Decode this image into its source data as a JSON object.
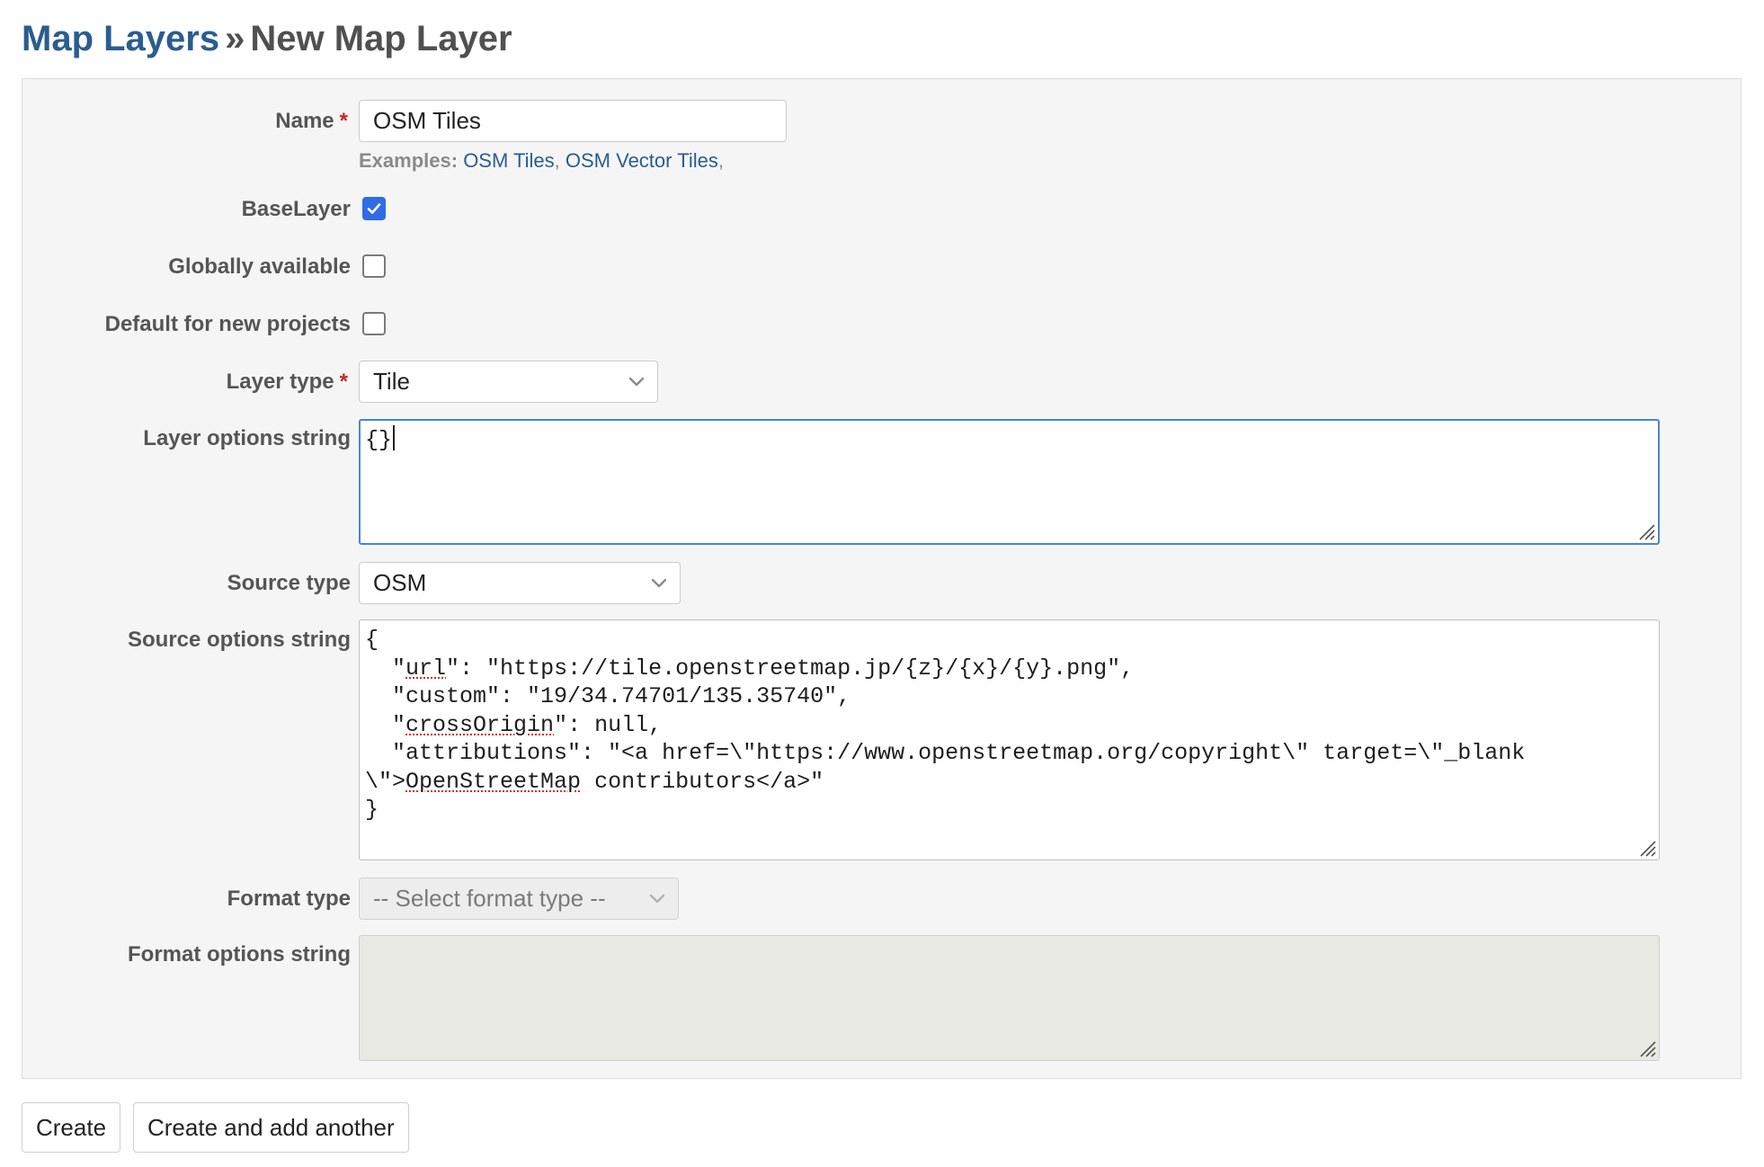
{
  "breadcrumb": {
    "parent_label": "Map Layers",
    "separator": "»",
    "current_label": "New Map Layer"
  },
  "form": {
    "name": {
      "label": "Name",
      "required_mark": "*",
      "value": "OSM Tiles",
      "help_label": "Examples:",
      "examples": [
        "OSM Tiles",
        "OSM Vector Tiles"
      ]
    },
    "base_layer": {
      "label": "BaseLayer",
      "checked": true
    },
    "globally_available": {
      "label": "Globally available",
      "checked": false
    },
    "default_for_new_projects": {
      "label": "Default for new projects",
      "checked": false
    },
    "layer_type": {
      "label": "Layer type",
      "required_mark": "*",
      "selected": "Tile"
    },
    "layer_options": {
      "label": "Layer options string",
      "value": "{}"
    },
    "source_type": {
      "label": "Source type",
      "selected": "OSM"
    },
    "source_options": {
      "label": "Source options string",
      "lines": [
        "{",
        "  \"url\": \"https://tile.openstreetmap.jp/{z}/{x}/{y}.png\",",
        "  \"custom\": \"19/34.74701/135.35740\",",
        "  \"crossOrigin\": null,",
        "  \"attributions\": \"<a href=\\\"https://www.openstreetmap.org/copyright\\\" target=\\\"_blank",
        "\\\">OpenStreetMap contributors</a>\"",
        "}"
      ]
    },
    "format_type": {
      "label": "Format type",
      "placeholder": "-- Select format type --",
      "disabled": true
    },
    "format_options": {
      "label": "Format options string",
      "value": "",
      "disabled": true
    }
  },
  "actions": {
    "create_label": "Create",
    "create_another_label": "Create and add another"
  },
  "colors": {
    "link": "#2a5d8f",
    "required": "#c0262a",
    "checkbox_checked": "#2f6ce5",
    "panel_bg": "#f5f5f5",
    "focus_border": "#4a86c8"
  }
}
